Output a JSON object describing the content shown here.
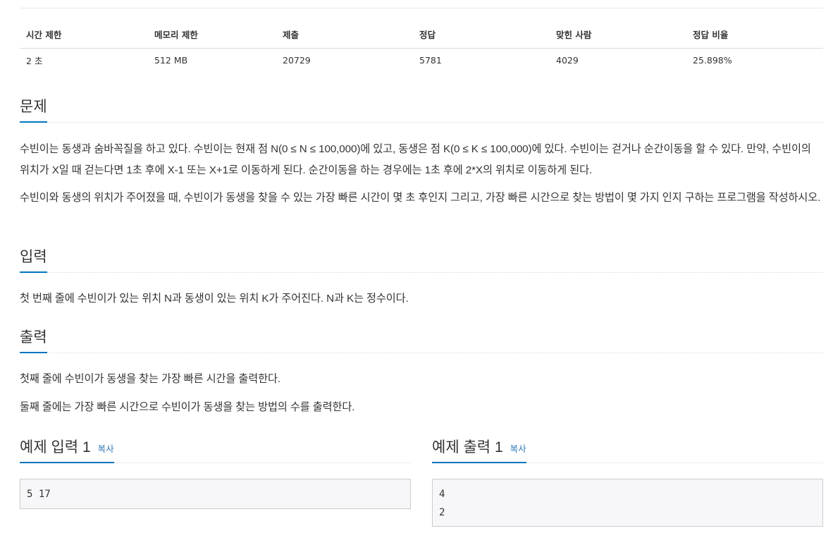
{
  "info_table": {
    "headers": [
      "시간 제한",
      "메모리 제한",
      "제출",
      "정답",
      "맞힌 사람",
      "정답 비율"
    ],
    "values": [
      "2 초",
      "512 MB",
      "20729",
      "5781",
      "4029",
      "25.898%"
    ]
  },
  "problem": {
    "title": "문제",
    "paragraphs": [
      "수빈이는 동생과 숨바꼭질을 하고 있다. 수빈이는 현재 점 N(0 ≤ N ≤ 100,000)에 있고, 동생은 점 K(0 ≤ K ≤ 100,000)에 있다. 수빈이는 걷거나 순간이동을 할 수 있다. 만약, 수빈이의 위치가 X일 때 걷는다면 1초 후에 X-1 또는 X+1로 이동하게 된다. 순간이동을 하는 경우에는 1초 후에 2*X의 위치로 이동하게 된다.",
      "수빈이와 동생의 위치가 주어졌을 때, 수빈이가 동생을 찾을 수 있는 가장 빠른 시간이 몇 초 후인지 그리고, 가장 빠른 시간으로 찾는 방법이 몇 가지 인지 구하는 프로그램을 작성하시오."
    ]
  },
  "input": {
    "title": "입력",
    "paragraphs": [
      "첫 번째 줄에 수빈이가 있는 위치 N과 동생이 있는 위치 K가 주어진다. N과 K는 정수이다."
    ]
  },
  "output": {
    "title": "출력",
    "paragraphs": [
      "첫째 줄에 수빈이가 동생을 찾는 가장 빠른 시간을 출력한다.",
      "둘째 줄에는 가장 빠른 시간으로 수빈이가 동생을 찾는 방법의 수를 출력한다."
    ]
  },
  "sample_input": {
    "title": "예제 입력 1",
    "copy_label": "복사",
    "content": "5 17"
  },
  "sample_output": {
    "title": "예제 출력 1",
    "copy_label": "복사",
    "content": "4\n2"
  },
  "colors": {
    "accent": "#0076c0",
    "link": "#337ab7"
  }
}
